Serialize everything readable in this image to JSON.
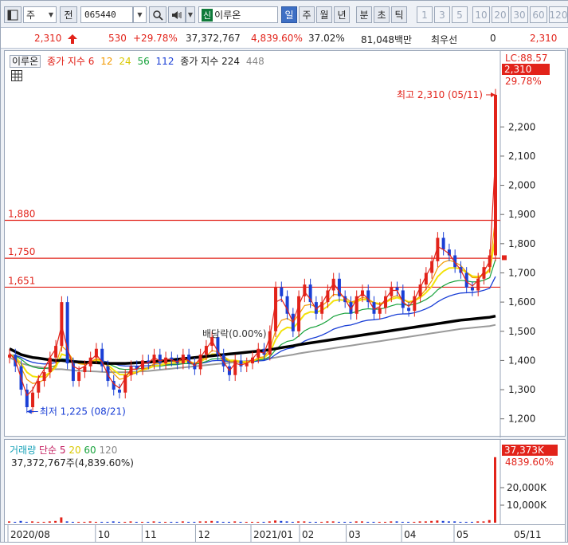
{
  "toolbar": {
    "market_label": "주",
    "full_label": "전",
    "stock_code": "065440",
    "badge_new": "신",
    "stock_name": "이루온",
    "periods": [
      "일",
      "주",
      "월",
      "년",
      "분",
      "초",
      "틱"
    ],
    "selected_period": "일",
    "counts": [
      "1",
      "3",
      "5",
      "10",
      "20",
      "30",
      "60",
      "120"
    ]
  },
  "price_row": {
    "price": "2,310",
    "change": "530",
    "change_pct": "+29.78%",
    "volume": "37,372,767",
    "volume_ratio": "4,839.60%",
    "turnover": "37.02%",
    "amount": "81,048백만",
    "ask_label": "최우선",
    "ask_qty": "0",
    "ask_price": "2,310"
  },
  "price_legend": {
    "name": "이루온",
    "ma_label": "종가 지수 6",
    "ma12": "12",
    "ma24": "24",
    "ma56": "56",
    "ma112": "112",
    "ma224_label": "종가 지수 224",
    "ma448": "448"
  },
  "annotations": {
    "high": "최고 2,310 (05/11)",
    "low": "최저 1,225 (08/21)",
    "dividend": "배당락(0.00%)",
    "lc": "LC:88.57",
    "last_price": "2,310",
    "last_pct": "29.78%"
  },
  "hlines": [
    {
      "label": "1,880",
      "value": 1880
    },
    {
      "label": "1,750",
      "value": 1750
    },
    {
      "label": "1,651",
      "value": 1651
    }
  ],
  "volume_legend": {
    "title": "거래량",
    "ma_label": "단순 5",
    "ma20": "20",
    "ma60": "60",
    "ma120": "120",
    "info": "37,372,767주(4,839.60%)",
    "last_volume": "37,373K",
    "last_pct": "4839.60%"
  },
  "colors": {
    "up": "#e2231a",
    "down": "#1a3fd6",
    "ma6": "#e2231a",
    "ma12": "#f39a00",
    "ma24": "#f2e20a",
    "ma56": "#17a23b",
    "ma112": "#1a3fd6",
    "ma224": "#000000",
    "ma448": "#9a9a9a"
  },
  "chart_data": {
    "type": "candlestick",
    "y_axis": {
      "min": 1150,
      "max": 2400,
      "ticks": [
        "2,200",
        "2,100",
        "2,000",
        "1,900",
        "1,800",
        "1,700",
        "1,600",
        "1,500",
        "1,400",
        "1,300",
        "1,200"
      ]
    },
    "x_axis": {
      "labels": [
        "2020/08",
        "10",
        "11",
        "12",
        "2021/01",
        "02",
        "03",
        "04",
        "05",
        "05/11"
      ]
    },
    "volume_axis": {
      "ticks": [
        "20,000K",
        "10,000K"
      ]
    },
    "series": [
      {
        "name": "종가",
        "values": [
          1420,
          1380,
          1300,
          1240,
          1290,
          1330,
          1360,
          1410,
          1450,
          1600,
          1390,
          1330,
          1360,
          1380,
          1410,
          1440,
          1380,
          1330,
          1300,
          1290,
          1350,
          1380,
          1370,
          1400,
          1390,
          1420,
          1390,
          1410,
          1400,
          1390,
          1420,
          1390,
          1370,
          1420,
          1450,
          1480,
          1420,
          1380,
          1350,
          1400,
          1380,
          1390,
          1410,
          1440,
          1420,
          1500,
          1650,
          1620,
          1560,
          1500,
          1620,
          1660,
          1600,
          1560,
          1600,
          1640,
          1680,
          1620,
          1600,
          1560,
          1620,
          1640,
          1600,
          1560,
          1580,
          1620,
          1650,
          1640,
          1580,
          1570,
          1620,
          1660,
          1700,
          1740,
          1820,
          1780,
          1760,
          1720,
          1700,
          1650,
          1640,
          1680,
          1720,
          1760,
          2310
        ]
      },
      {
        "name": "종가 지수 6",
        "values": [
          1425,
          1400,
          1340,
          1280,
          1300,
          1340,
          1370,
          1410,
          1440,
          1520,
          1440,
          1380,
          1370,
          1380,
          1400,
          1420,
          1395,
          1350,
          1320,
          1305,
          1340,
          1370,
          1370,
          1390,
          1392,
          1410,
          1398,
          1405,
          1402,
          1395,
          1412,
          1398,
          1382,
          1410,
          1440,
          1468,
          1430,
          1395,
          1365,
          1390,
          1385,
          1390,
          1405,
          1430,
          1425,
          1480,
          1600,
          1610,
          1575,
          1530,
          1590,
          1635,
          1610,
          1575,
          1595,
          1630,
          1665,
          1635,
          1610,
          1575,
          1610,
          1630,
          1610,
          1575,
          1585,
          1610,
          1640,
          1640,
          1600,
          1585,
          1610,
          1650,
          1690,
          1725,
          1790,
          1780,
          1765,
          1735,
          1710,
          1670,
          1655,
          1675,
          1705,
          1740,
          2100
        ]
      },
      {
        "name": "224",
        "values": [
          1440,
          1430,
          1420,
          1415,
          1410,
          1408,
          1405,
          1402,
          1400,
          1400,
          1398,
          1396,
          1395,
          1394,
          1393,
          1392,
          1391,
          1390,
          1390,
          1390,
          1390,
          1391,
          1392,
          1393,
          1394,
          1396,
          1398,
          1400,
          1402,
          1404,
          1406,
          1408,
          1410,
          1412,
          1414,
          1416,
          1418,
          1420,
          1422,
          1424,
          1426,
          1428,
          1430,
          1432,
          1434,
          1437,
          1440,
          1444,
          1447,
          1450,
          1454,
          1457,
          1460,
          1463,
          1466,
          1469,
          1472,
          1475,
          1478,
          1481,
          1484,
          1487,
          1490,
          1493,
          1496,
          1499,
          1502,
          1505,
          1508,
          1511,
          1514,
          1517,
          1520,
          1523,
          1526,
          1529,
          1532,
          1535,
          1538,
          1540,
          1542,
          1544,
          1546,
          1548,
          1552
        ]
      }
    ],
    "volume": [
      3,
      2,
      4,
      2,
      3,
      2,
      2,
      3,
      4,
      12,
      3,
      2,
      2,
      2,
      3,
      2,
      2,
      2,
      3,
      2,
      2,
      3,
      2,
      2,
      2,
      3,
      2,
      2,
      2,
      2,
      3,
      2,
      2,
      3,
      3,
      4,
      3,
      2,
      2,
      3,
      2,
      2,
      2,
      2,
      2,
      3,
      5,
      4,
      3,
      2,
      3,
      3,
      2,
      2,
      2,
      3,
      3,
      2,
      2,
      2,
      3,
      3,
      2,
      2,
      2,
      2,
      3,
      3,
      2,
      2,
      2,
      3,
      3,
      4,
      5,
      4,
      3,
      3,
      2,
      2,
      2,
      3,
      3,
      6,
      37373
    ]
  }
}
